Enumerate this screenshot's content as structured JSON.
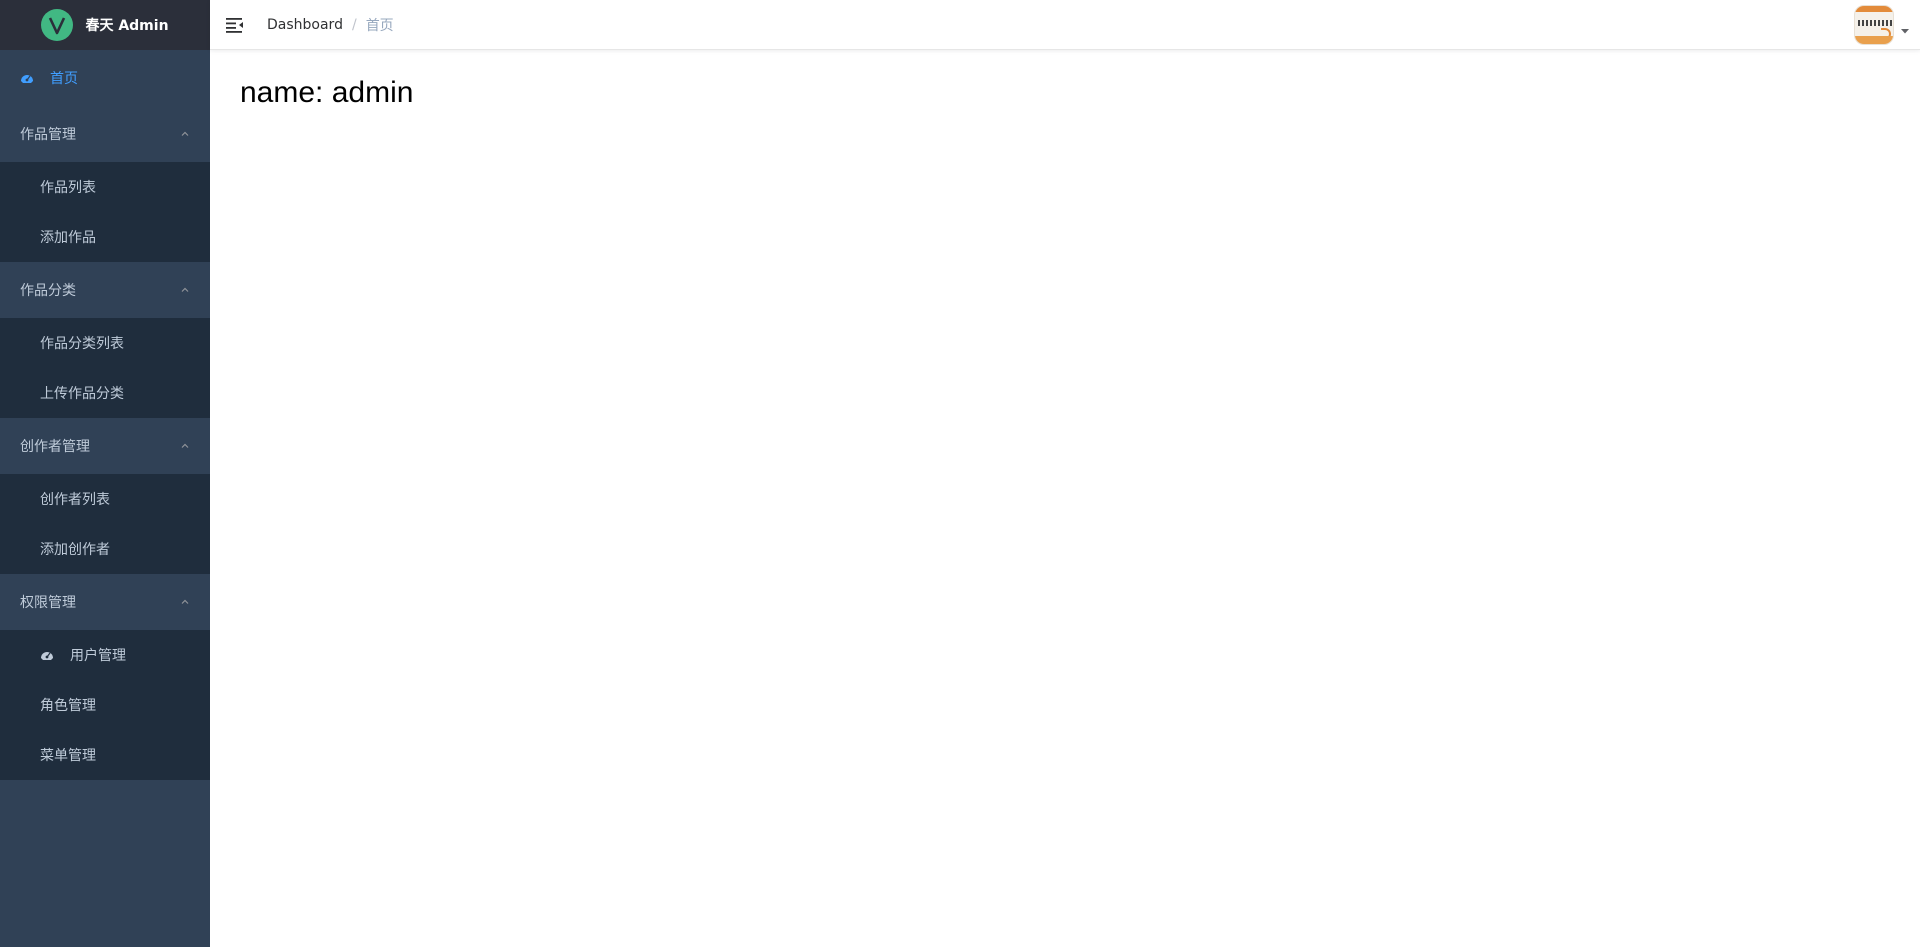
{
  "app": {
    "title": "春天 Admin"
  },
  "sidebar": {
    "home_label": "首页",
    "groups": [
      {
        "title": "作品管理",
        "items": [
          {
            "label": "作品列表"
          },
          {
            "label": "添加作品"
          }
        ]
      },
      {
        "title": "作品分类",
        "items": [
          {
            "label": "作品分类列表"
          },
          {
            "label": "上传作品分类"
          }
        ]
      },
      {
        "title": "创作者管理",
        "items": [
          {
            "label": "创作者列表"
          },
          {
            "label": "添加创作者"
          }
        ]
      },
      {
        "title": "权限管理",
        "items": [
          {
            "label": "用户管理"
          },
          {
            "label": "角色管理"
          },
          {
            "label": "菜单管理"
          }
        ]
      }
    ]
  },
  "navbar": {
    "breadcrumb": {
      "root": "Dashboard",
      "separator": "/",
      "current": "首页"
    }
  },
  "main": {
    "dashboard_text": "name: admin"
  },
  "colors": {
    "sidebar_bg": "#304156",
    "submenu_bg": "#1f2d3d",
    "logo_bg": "#2b2f3a",
    "active": "#409eff",
    "menu_text": "#bfcbd9",
    "logo_green": "#41b883"
  },
  "icons": {
    "logo": "vue-logo-icon",
    "home": "dashboard-icon",
    "submenu_arrow": "chevron-up-icon",
    "user_management": "dashboard-icon",
    "hamburger": "hamburger-icon",
    "dropdown": "caret-down-icon"
  }
}
